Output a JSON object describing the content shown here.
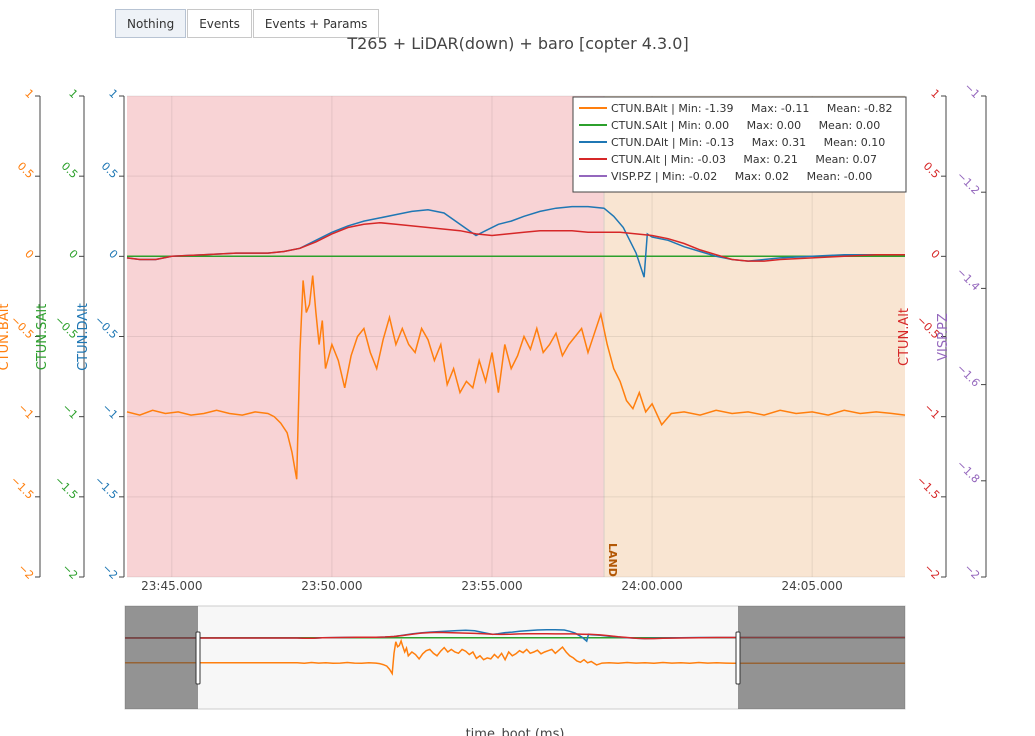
{
  "buttons": [
    {
      "label": "Nothing",
      "active": true
    },
    {
      "label": "Events",
      "active": false
    },
    {
      "label": "Events + Params",
      "active": false
    }
  ],
  "chart_data": {
    "type": "line",
    "title": "T265 + LiDAR(down) + baro [copter 4.3.0]",
    "xlabel": "time_boot (ms)",
    "x_ticks": [
      "23:45.000",
      "23:50.000",
      "23:55.000",
      "24:00.000",
      "24:05.000"
    ],
    "x_tick_seconds": [
      45,
      50,
      55,
      60,
      65
    ],
    "x_range_seconds": [
      43.6,
      67.9
    ],
    "x_range_labels": [
      "23:43.600",
      "24:07.900"
    ],
    "mode_bands": [
      {
        "from": 43.6,
        "to": 58.5,
        "color": "#f8d3d5",
        "label": ""
      },
      {
        "from": 58.5,
        "to": 67.9,
        "color": "#f9e5d2",
        "label": "LAND"
      }
    ],
    "event_label_color": "#b35806",
    "legend_position": "top-right",
    "axes": [
      {
        "id": "baltAxis",
        "label": "CTUN.BAlt",
        "color": "#ff7f0e",
        "side": "left",
        "range": [
          -2,
          1
        ],
        "ticks": [
          1,
          0.5,
          0,
          -0.5,
          -1,
          -1.5,
          -2
        ],
        "tick_labels": [
          "1",
          "0.5",
          "0",
          "−0.5",
          "−1",
          "−1.5",
          "−2"
        ]
      },
      {
        "id": "saltAxis",
        "label": "CTUN.SAlt",
        "color": "#2ca02c",
        "side": "left",
        "range": [
          -2,
          1
        ],
        "ticks": [
          1,
          0.5,
          0,
          -0.5,
          -1,
          -1.5,
          -2
        ],
        "tick_labels": [
          "1",
          "0.5",
          "0",
          "−0.5",
          "−1",
          "−1.5",
          "−2"
        ]
      },
      {
        "id": "daltAxis",
        "label": "CTUN.DAlt",
        "color": "#1f77b4",
        "side": "left",
        "range": [
          -2,
          1
        ],
        "ticks": [
          1,
          0.5,
          0,
          -0.5,
          -1,
          -1.5,
          -2
        ],
        "tick_labels": [
          "1",
          "0.5",
          "0",
          "−0.5",
          "−1",
          "−1.5",
          "−2"
        ]
      },
      {
        "id": "altAxis",
        "label": "CTUN.Alt",
        "color": "#d62728",
        "side": "right",
        "range": [
          -2,
          1
        ],
        "ticks": [
          1,
          0.5,
          0,
          -0.5,
          -1,
          -1.5,
          -2
        ],
        "tick_labels": [
          "1",
          "0.5",
          "0",
          "−0.5",
          "−1",
          "−1.5",
          "−2"
        ]
      },
      {
        "id": "pzAxis",
        "label": "VISP.PZ",
        "color": "#9467bd",
        "side": "right",
        "range": [
          -2,
          -1
        ],
        "ticks": [
          -1,
          -1.2,
          -1.4,
          -1.6,
          -1.8,
          -2
        ],
        "tick_labels": [
          "−1",
          "−1.2",
          "−1.4",
          "−1.6",
          "−1.8",
          "−2"
        ]
      }
    ],
    "series": [
      {
        "name": "CTUN.BAlt",
        "color": "#ff7f0e",
        "axis": "baltAxis",
        "stats": "| Min: -1.39     Max: -0.11     Mean: -0.82",
        "x": [
          43.6,
          44.0,
          44.4,
          44.8,
          45.2,
          45.6,
          46.0,
          46.4,
          46.8,
          47.2,
          47.6,
          48.0,
          48.2,
          48.4,
          48.6,
          48.75,
          48.9,
          49.0,
          49.1,
          49.2,
          49.3,
          49.4,
          49.5,
          49.6,
          49.7,
          49.8,
          50.0,
          50.2,
          50.4,
          50.6,
          50.8,
          51.0,
          51.2,
          51.4,
          51.6,
          51.8,
          52.0,
          52.2,
          52.4,
          52.6,
          52.8,
          53.0,
          53.2,
          53.4,
          53.6,
          53.8,
          54.0,
          54.2,
          54.4,
          54.6,
          54.8,
          55.0,
          55.2,
          55.4,
          55.6,
          55.8,
          56.0,
          56.2,
          56.4,
          56.6,
          56.8,
          57.0,
          57.2,
          57.4,
          57.6,
          57.8,
          58.0,
          58.2,
          58.4,
          58.6,
          58.8,
          59.0,
          59.2,
          59.4,
          59.6,
          59.8,
          60.0,
          60.3,
          60.6,
          61.0,
          61.5,
          62.0,
          62.5,
          63.0,
          63.5,
          64.0,
          64.5,
          65.0,
          65.5,
          66.0,
          66.5,
          67.0,
          67.5,
          67.9
        ],
        "y": [
          -0.97,
          -0.99,
          -0.96,
          -0.98,
          -0.97,
          -0.99,
          -0.98,
          -0.96,
          -0.98,
          -0.99,
          -0.97,
          -0.98,
          -1.0,
          -1.04,
          -1.1,
          -1.22,
          -1.39,
          -0.6,
          -0.15,
          -0.35,
          -0.3,
          -0.12,
          -0.35,
          -0.55,
          -0.4,
          -0.7,
          -0.55,
          -0.65,
          -0.82,
          -0.62,
          -0.5,
          -0.45,
          -0.6,
          -0.7,
          -0.52,
          -0.38,
          -0.55,
          -0.45,
          -0.55,
          -0.6,
          -0.45,
          -0.52,
          -0.65,
          -0.55,
          -0.8,
          -0.7,
          -0.85,
          -0.78,
          -0.82,
          -0.65,
          -0.78,
          -0.6,
          -0.85,
          -0.55,
          -0.7,
          -0.62,
          -0.5,
          -0.58,
          -0.45,
          -0.6,
          -0.55,
          -0.48,
          -0.62,
          -0.55,
          -0.5,
          -0.45,
          -0.6,
          -0.48,
          -0.36,
          -0.55,
          -0.7,
          -0.78,
          -0.9,
          -0.95,
          -0.85,
          -0.97,
          -0.92,
          -1.05,
          -0.98,
          -0.97,
          -0.99,
          -0.96,
          -0.98,
          -0.97,
          -0.99,
          -0.96,
          -0.98,
          -0.97,
          -0.99,
          -0.96,
          -0.98,
          -0.97,
          -0.98,
          -0.99
        ]
      },
      {
        "name": "CTUN.SAlt",
        "color": "#2ca02c",
        "axis": "saltAxis",
        "stats": "| Min: 0.00     Max: 0.00     Mean: 0.00",
        "x": [
          43.6,
          67.9
        ],
        "y": [
          0.0,
          0.0
        ]
      },
      {
        "name": "CTUN.DAlt",
        "color": "#1f77b4",
        "axis": "daltAxis",
        "stats": "| Min: -0.13     Max: 0.31     Mean: 0.10",
        "x": [
          43.6,
          44.0,
          44.5,
          45.0,
          46.0,
          47.0,
          48.0,
          48.5,
          49.0,
          49.5,
          50.0,
          50.5,
          51.0,
          51.5,
          52.0,
          52.5,
          53.0,
          53.5,
          54.0,
          54.5,
          54.8,
          55.2,
          55.6,
          56.0,
          56.5,
          57.0,
          57.5,
          58.0,
          58.5,
          58.8,
          59.1,
          59.3,
          59.5,
          59.75,
          59.85,
          60.0,
          60.5,
          61.0,
          61.5,
          62.0,
          62.5,
          63.0,
          63.5,
          64.0,
          65.0,
          66.0,
          67.0,
          67.9
        ],
        "y": [
          -0.01,
          -0.02,
          -0.02,
          0.0,
          0.01,
          0.02,
          0.02,
          0.03,
          0.05,
          0.1,
          0.15,
          0.19,
          0.22,
          0.24,
          0.26,
          0.28,
          0.29,
          0.27,
          0.2,
          0.13,
          0.16,
          0.2,
          0.22,
          0.25,
          0.28,
          0.3,
          0.31,
          0.31,
          0.3,
          0.25,
          0.18,
          0.1,
          0.02,
          -0.13,
          0.14,
          0.12,
          0.1,
          0.06,
          0.03,
          0.0,
          -0.02,
          -0.03,
          -0.02,
          -0.01,
          0.0,
          0.01,
          0.01,
          0.01
        ]
      },
      {
        "name": "CTUN.Alt",
        "color": "#d62728",
        "axis": "altAxis",
        "stats": "| Min: -0.03     Max: 0.21     Mean: 0.07",
        "x": [
          43.6,
          44.0,
          44.5,
          45.0,
          46.0,
          47.0,
          48.0,
          48.5,
          49.0,
          49.5,
          50.0,
          50.5,
          51.0,
          51.5,
          52.0,
          52.5,
          53.0,
          53.5,
          54.0,
          54.5,
          55.0,
          55.5,
          56.0,
          56.5,
          57.0,
          57.5,
          58.0,
          58.5,
          59.0,
          59.5,
          60.0,
          60.5,
          61.0,
          61.5,
          62.0,
          62.5,
          63.0,
          63.5,
          64.0,
          65.0,
          66.0,
          67.0,
          67.9
        ],
        "y": [
          -0.01,
          -0.02,
          -0.02,
          0.0,
          0.01,
          0.02,
          0.02,
          0.03,
          0.05,
          0.09,
          0.14,
          0.18,
          0.2,
          0.21,
          0.2,
          0.19,
          0.18,
          0.17,
          0.16,
          0.14,
          0.13,
          0.14,
          0.15,
          0.16,
          0.16,
          0.16,
          0.15,
          0.15,
          0.15,
          0.14,
          0.13,
          0.11,
          0.08,
          0.04,
          0.01,
          -0.02,
          -0.03,
          -0.03,
          -0.02,
          -0.01,
          0.0,
          0.01,
          0.01
        ]
      },
      {
        "name": "VISP.PZ",
        "color": "#9467bd",
        "axis": "pzAxis",
        "stats": "| Min: -0.02     Max: 0.02     Mean: -0.00",
        "x": [],
        "y": []
      }
    ]
  }
}
